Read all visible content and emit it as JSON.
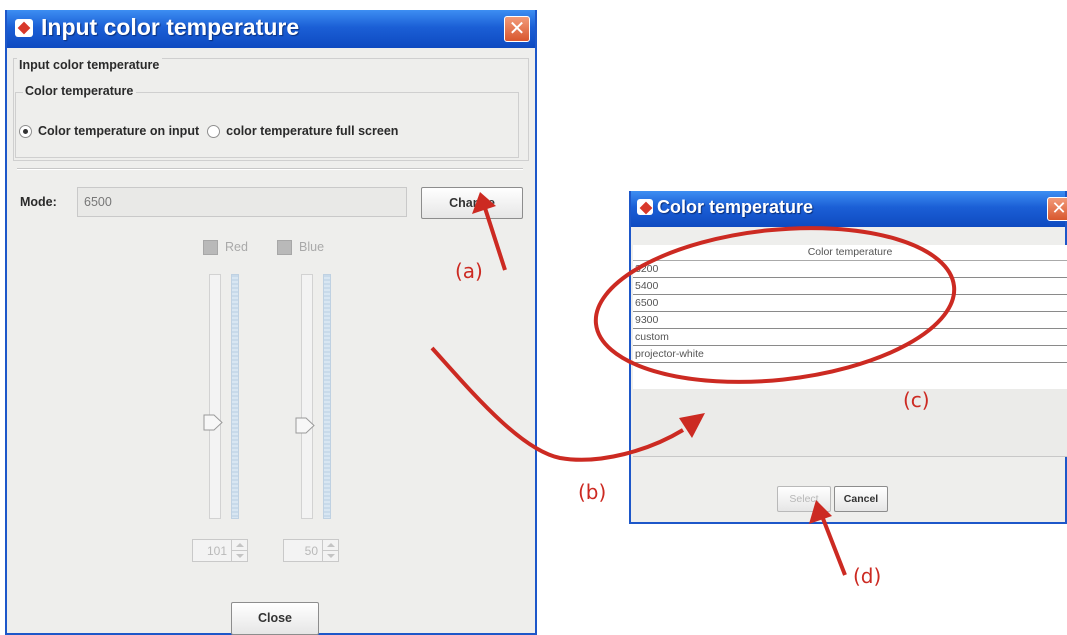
{
  "main_window": {
    "title": "Input color temperature",
    "close_glyph": "✕",
    "group_outer_label": "Input color temperature",
    "group_inner_label": "Color temperature",
    "radio_options": [
      {
        "label": "Color temperature on input",
        "selected": true
      },
      {
        "label": "color temperature full screen",
        "selected": false
      }
    ],
    "mode_label": "Mode:",
    "mode_value": "6500",
    "change_label": "Change",
    "checkbox_red": "Red",
    "checkbox_blue": "Blue",
    "red_value": "101",
    "blue_value": "50",
    "close_label": "Close"
  },
  "dialog": {
    "title": "Color temperature",
    "close_glyph": "✕",
    "column_header": "Color temperature",
    "rows": [
      "3200",
      "5400",
      "6500",
      "9300",
      "custom",
      "projector-white"
    ],
    "select_label": "Select",
    "cancel_label": "Cancel"
  },
  "annotations": {
    "color": "#cc2a22",
    "labels": [
      "(a)",
      "(b)",
      "(c)",
      "(d)"
    ]
  },
  "colors": {
    "title_bar": "#1b5fd6",
    "window_bg": "#eeeeec",
    "close_button": "#d8572e"
  },
  "icons": [
    "app-icon",
    "close-icon",
    "radio-icon",
    "slider-thumb-icon",
    "spinner-arrow-icon"
  ]
}
